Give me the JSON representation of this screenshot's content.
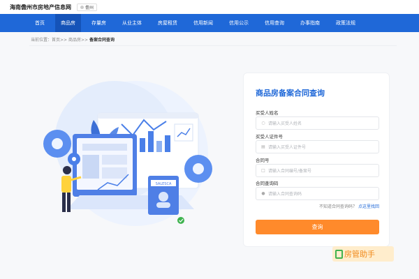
{
  "header": {
    "site_title": "海南儋州市房地产信息网",
    "location": "儋州"
  },
  "nav": {
    "items": [
      "首页",
      "商品房",
      "存量房",
      "从业主体",
      "房屋租赁",
      "信用新闻",
      "信用公示",
      "信用查询",
      "办事指南",
      "政策法规"
    ],
    "active_index": 1
  },
  "breadcrumb": {
    "prefix": "当前位置：",
    "home": "首页",
    "sep": ">>",
    "section": "商品房",
    "current": "备案合同查询"
  },
  "illustration": {
    "card_label": "SALESCA"
  },
  "form": {
    "title": "商品房备案合同查询",
    "fields": [
      {
        "label": "买受人姓名",
        "placeholder": "请输入买受人姓名",
        "icon": "person-icon"
      },
      {
        "label": "买受人证件号",
        "placeholder": "请输入买受人证件号",
        "icon": "id-card-icon"
      },
      {
        "label": "合同号",
        "placeholder": "请输入合同编号/备案号",
        "icon": "document-icon"
      },
      {
        "label": "合同查询码",
        "placeholder": "请输入合同查询码",
        "icon": "lock-icon"
      }
    ],
    "forgot_text": "不知道合同查询码？",
    "forgot_link": "点这里找回",
    "submit_label": "查询"
  },
  "watermark": {
    "text": "房管助手"
  },
  "colors": {
    "brand_blue": "#1f68d8",
    "active_nav": "#1553b8",
    "button_orange": "#ff8a2b"
  }
}
